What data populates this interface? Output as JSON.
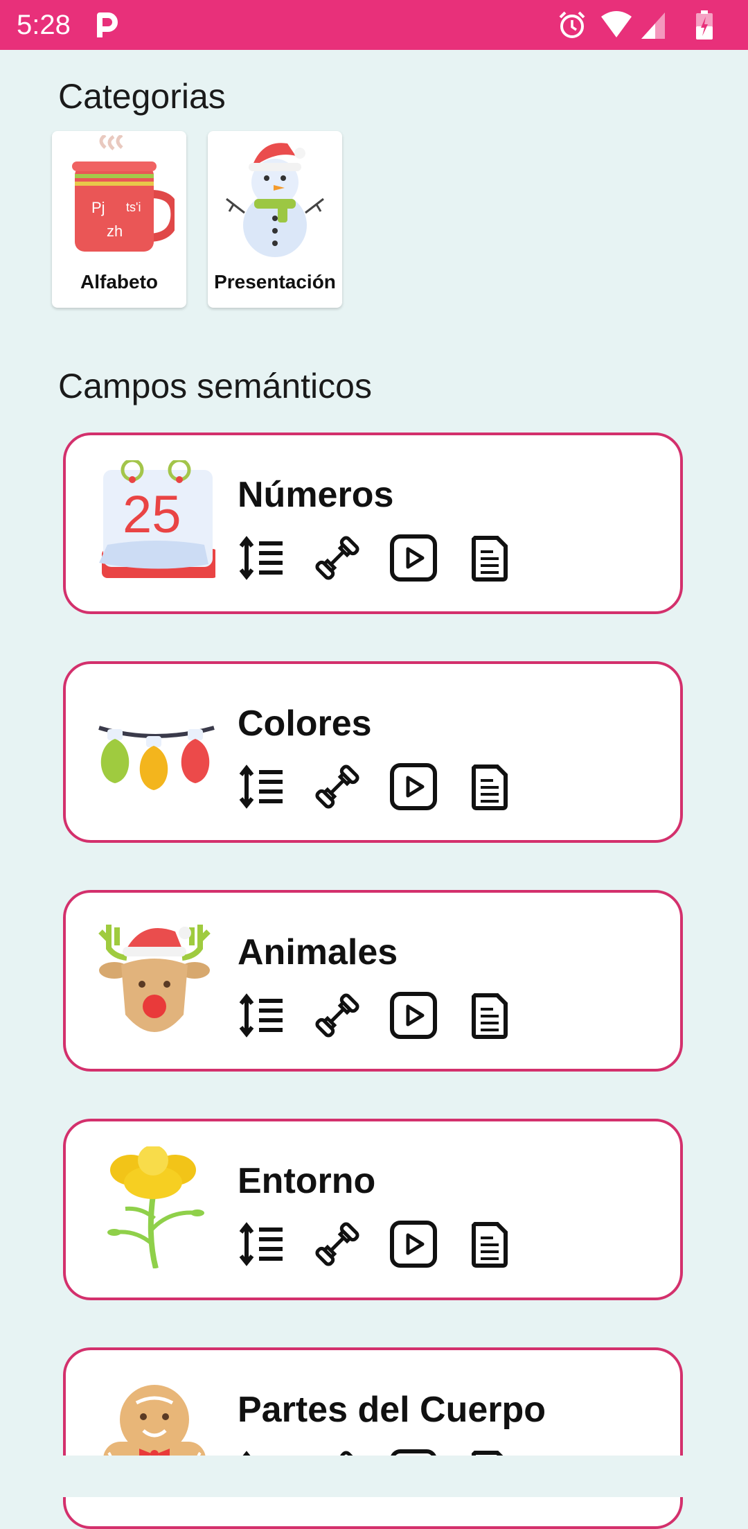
{
  "status_bar": {
    "time": "5:28",
    "app_icon": "p-icon",
    "icons": [
      "alarm-icon",
      "wifi-icon",
      "signal-icon",
      "battery-icon"
    ],
    "color": "#e8307a"
  },
  "categories": {
    "title": "Categorias",
    "items": [
      {
        "label": "Alfabeto",
        "icon": "mug-icon",
        "icon_text": [
          "Pj",
          "ts'i",
          "zh"
        ]
      },
      {
        "label": "Presentación",
        "icon": "snowman-icon"
      }
    ]
  },
  "semantic_fields": {
    "title": "Campos semánticos",
    "accent": "#d3306c",
    "items": [
      {
        "title": "Números",
        "icon": "calendar-icon",
        "calendar_number": "25"
      },
      {
        "title": "Colores",
        "icon": "lights-icon"
      },
      {
        "title": "Animales",
        "icon": "reindeer-icon"
      },
      {
        "title": "Entorno",
        "icon": "flower-icon"
      },
      {
        "title": "Partes del Cuerpo",
        "icon": "gingerbread-icon"
      }
    ],
    "actions": [
      "list-sort-icon",
      "dumbbell-icon",
      "play-icon",
      "document-icon"
    ]
  }
}
